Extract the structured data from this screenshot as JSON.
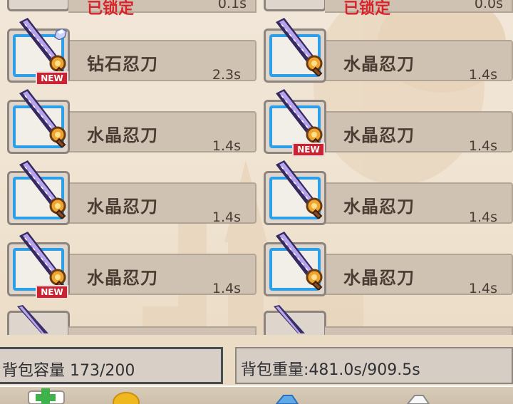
{
  "items": [
    {
      "name": "钻石忍刀",
      "time": "2.3s",
      "is_new": true,
      "gem": true
    },
    {
      "name": "水晶忍刀",
      "time": "1.4s",
      "is_new": false,
      "gem": false
    },
    {
      "name": "水晶忍刀",
      "time": "1.4s",
      "is_new": false,
      "gem": false
    },
    {
      "name": "水晶忍刀",
      "time": "1.4s",
      "is_new": true,
      "gem": false
    },
    {
      "name": "水晶忍刀",
      "time": "1.4s",
      "is_new": false,
      "gem": false
    },
    {
      "name": "水晶忍刀",
      "time": "1.4s",
      "is_new": false,
      "gem": false
    },
    {
      "name": "水晶忍刀",
      "time": "1.4s",
      "is_new": true,
      "gem": false
    },
    {
      "name": "水晶忍刀",
      "time": "1.4s",
      "is_new": false,
      "gem": false
    }
  ],
  "top_partial": [
    {
      "status": "已锁定",
      "time": "0.1s"
    },
    {
      "status": "已锁定",
      "time": "0.0s"
    }
  ],
  "badge_new_label": "NEW",
  "footer": {
    "capacity": "背包容量 173/200",
    "weight": "背包重量:481.0s/909.5s"
  },
  "bottom_icons": [
    "green-plus-icon",
    "gold-coin-icon",
    "blue-gem-icon",
    "white-crystal-icon"
  ],
  "colors": {
    "frame_blue": "#2d9fe8",
    "locked_red": "#d8232a",
    "new_red": "#c72330"
  }
}
